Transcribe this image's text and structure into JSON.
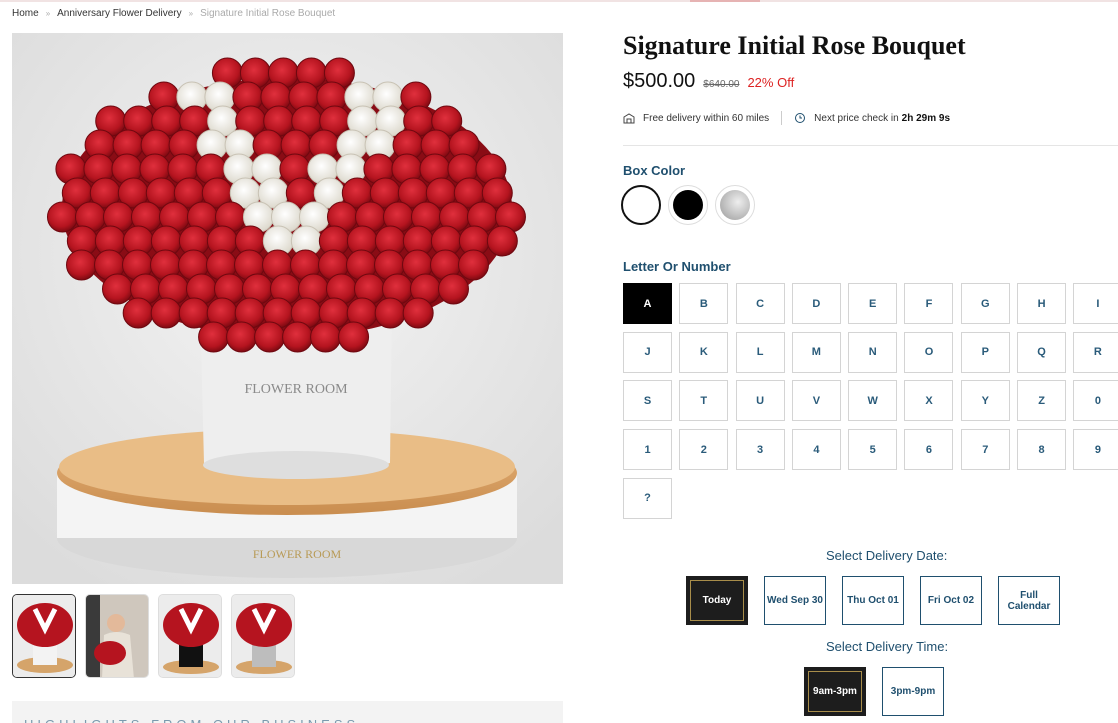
{
  "breadcrumb": {
    "home": "Home",
    "category": "Anniversary Flower Delivery",
    "current": "Signature Initial Rose Bouquet",
    "separator": "»"
  },
  "product": {
    "title": "Signature Initial Rose Bouquet",
    "price": "$500.00",
    "old_price": "$640.00",
    "discount": "22% Off",
    "image_icon": "rose-bouquet-image",
    "box_text": "FLOWER ROOM"
  },
  "info": {
    "delivery": "Free delivery within 60 miles",
    "price_check_prefix": "Next price check in",
    "price_check_time": "2h 29m 9s"
  },
  "box_color": {
    "label": "Box Color",
    "options": [
      {
        "name": "white",
        "color": "#ffffff"
      },
      {
        "name": "black",
        "color": "#000000"
      },
      {
        "name": "silver",
        "color": "#b5b5b5"
      }
    ]
  },
  "letter": {
    "label": "Letter Or Number",
    "selected": "A",
    "options": [
      "A",
      "B",
      "C",
      "D",
      "E",
      "F",
      "G",
      "H",
      "I",
      "J",
      "K",
      "L",
      "M",
      "N",
      "O",
      "P",
      "Q",
      "R",
      "S",
      "T",
      "U",
      "V",
      "W",
      "X",
      "Y",
      "Z",
      "0",
      "1",
      "2",
      "3",
      "4",
      "5",
      "6",
      "7",
      "8",
      "9",
      "?"
    ]
  },
  "delivery": {
    "date_label": "Select Delivery Date:",
    "dates": [
      "Today",
      "Wed Sep 30",
      "Thu Oct 01",
      "Fri Oct 02",
      "Full Calendar"
    ],
    "time_label": "Select Delivery Time:",
    "times": [
      "9am-3pm",
      "3pm-9pm"
    ]
  },
  "highlights": {
    "label": "HIGHLIGHTS FROM OUR BUSINESS"
  },
  "colors": {
    "accent": "#1f4f6e",
    "discount": "#dd2222",
    "gold": "#a88d4a"
  }
}
